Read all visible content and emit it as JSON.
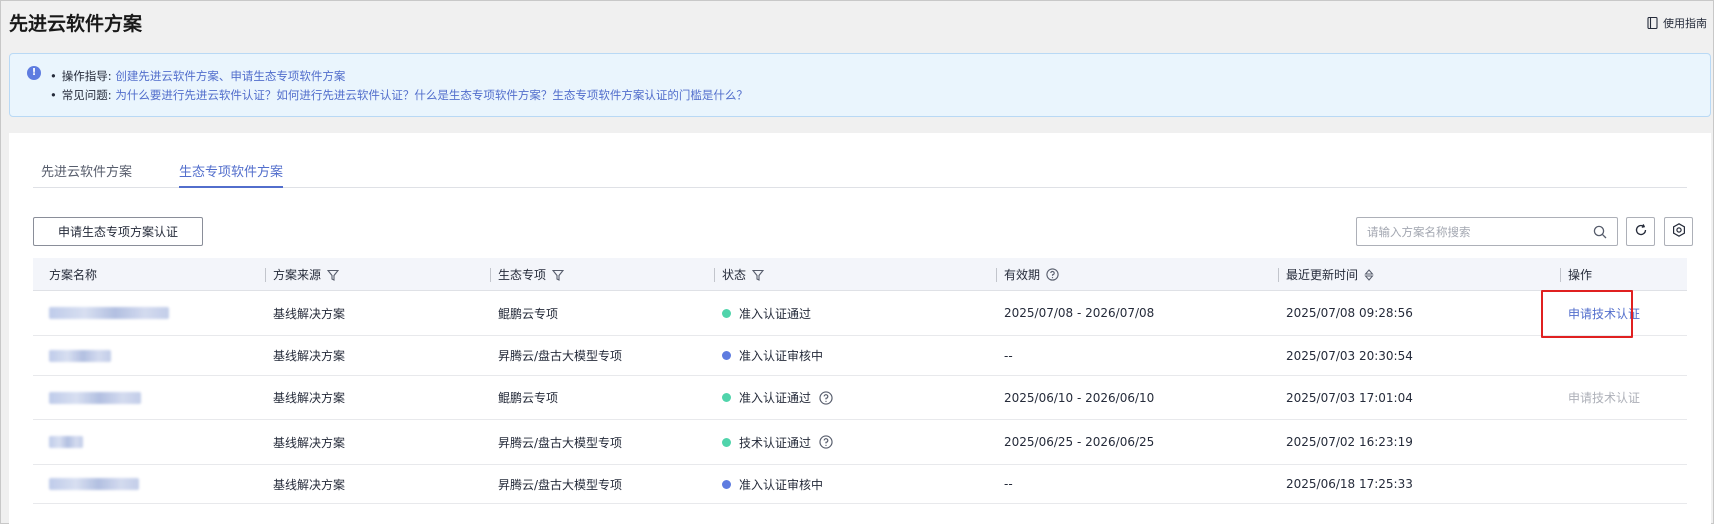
{
  "header": {
    "title": "先进云软件方案",
    "guide_label": "使用指南"
  },
  "tips": {
    "line1_label": "操作指导:",
    "line1_links": "创建先进云软件方案、申请生态专项软件方案",
    "line2_label": "常见问题:",
    "line2_links": "为什么要进行先进云软件认证？如何进行先进云软件认证？什么是生态专项软件方案？生态专项软件方案认证的门槛是什么？"
  },
  "tabs": [
    {
      "label": "先进云软件方案",
      "active": false
    },
    {
      "label": "生态专项软件方案",
      "active": true
    }
  ],
  "toolbar": {
    "apply_label": "申请生态专项方案认证",
    "search_placeholder": "请输入方案名称搜索"
  },
  "table": {
    "columns": [
      "方案名称",
      "方案来源",
      "生态专项",
      "状态",
      "有效期",
      "最近更新时间",
      "操作"
    ],
    "rows": [
      {
        "source": "基线解决方案",
        "eco": "鲲鹏云专项",
        "status": "准入认证通过",
        "status_color": "#50d4ab",
        "status_help": false,
        "validity": "2025/07/08 - 2026/07/08",
        "updated": "2025/07/08 09:28:56",
        "action": "申请技术认证",
        "action_enabled": true,
        "action_highlight": true
      },
      {
        "source": "基线解决方案",
        "eco": "昇腾云/盘古大模型专项",
        "status": "准入认证审核中",
        "status_color": "#5e7ce0",
        "status_help": false,
        "validity": "--",
        "updated": "2025/07/03 20:30:54",
        "action": "",
        "action_enabled": false,
        "action_highlight": false
      },
      {
        "source": "基线解决方案",
        "eco": "鲲鹏云专项",
        "status": "准入认证通过",
        "status_color": "#50d4ab",
        "status_help": true,
        "validity": "2025/06/10 - 2026/06/10",
        "updated": "2025/07/03 17:01:04",
        "action": "申请技术认证",
        "action_enabled": false,
        "action_highlight": false
      },
      {
        "source": "基线解决方案",
        "eco": "昇腾云/盘古大模型专项",
        "status": "技术认证通过",
        "status_color": "#50d4ab",
        "status_help": true,
        "validity": "2025/06/25 - 2026/06/25",
        "updated": "2025/07/02 16:23:19",
        "action": "",
        "action_enabled": false,
        "action_highlight": false
      },
      {
        "source": "基线解决方案",
        "eco": "昇腾云/盘古大模型专项",
        "status": "准入认证审核中",
        "status_color": "#5e7ce0",
        "status_help": false,
        "validity": "--",
        "updated": "2025/06/18 17:25:33",
        "action": "",
        "action_enabled": false,
        "action_highlight": false
      }
    ]
  }
}
